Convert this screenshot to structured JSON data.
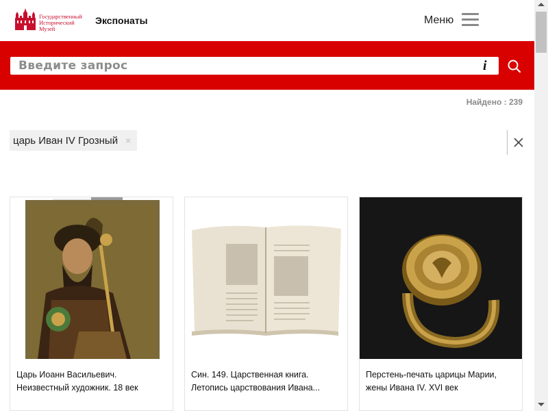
{
  "header": {
    "logo_lines": [
      "Государственный",
      "Исторический",
      "Музей"
    ],
    "section_title": "Экспонаты",
    "menu_label": "Меню"
  },
  "search": {
    "placeholder": "Введите запрос",
    "info_glyph": "i"
  },
  "results": {
    "found_text": "Найдено : 239",
    "active_filter": "царь Иван IV Грозный",
    "filter_remove_glyph": "×"
  },
  "cards": [
    {
      "caption_line1": "Царь Иоанн Васильевич.",
      "caption_line2": "Неизвестный художник. 18 век"
    },
    {
      "caption_line1": "Син. 149. Царственная книга.",
      "caption_line2": "Летопись царствования Ивана..."
    },
    {
      "caption_line1": "Перстень-печать царицы Марии,",
      "caption_line2": "жены Ивана IV. XVI век"
    }
  ],
  "colors": {
    "accent_red": "#d90000",
    "logo_red": "#c8102e",
    "found_gray": "#8a8a8a"
  }
}
